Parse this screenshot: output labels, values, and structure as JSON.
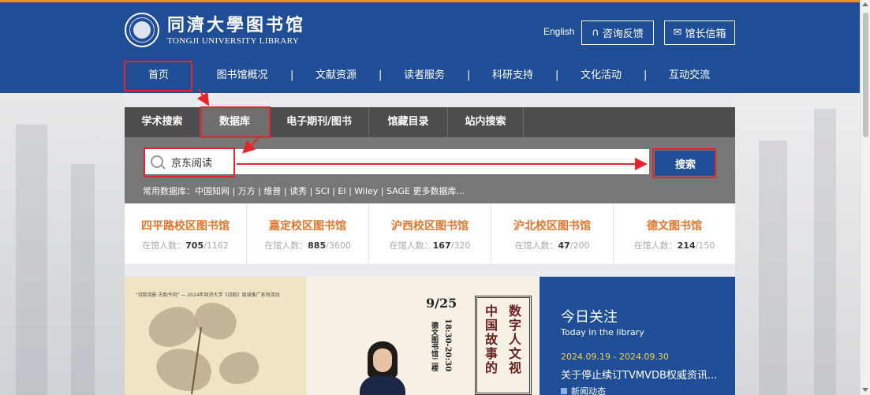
{
  "header": {
    "logo_cn": "同濟大學图书馆",
    "logo_en": "TONGJI UNIVERSITY LIBRARY",
    "lang_link": "English",
    "feedback_label": "咨询反馈",
    "feedback_icon": "headset-icon",
    "mailbox_label": "馆长信箱",
    "mailbox_icon": "mail-icon",
    "accent_color": "#1f4e96",
    "top_stripe_color": "#f08a24"
  },
  "nav": {
    "items": [
      "首页",
      "图书馆概况",
      "文献资源",
      "读者服务",
      "科研支持",
      "文化活动",
      "互动交流"
    ],
    "separator": "|"
  },
  "search": {
    "tabs": [
      "学术搜索",
      "数据库",
      "电子期刊/图书",
      "馆藏目录",
      "站内搜索"
    ],
    "active_tab": "数据库",
    "input_value": "京东阅读",
    "button_label": "搜索",
    "db_links_text": "常用数据库：中国知网 | 万方 | 维普 | 读秀 | SCI | EI | Wiley | SAGE   更多数据库..."
  },
  "campuses": [
    {
      "name": "四平路校区图书馆",
      "label": "在馆人数：",
      "current": "705",
      "capacity": "/1162"
    },
    {
      "name": "嘉定校区图书馆",
      "label": "在馆人数：",
      "current": "885",
      "capacity": "/3600"
    },
    {
      "name": "沪西校区图书馆",
      "label": "在馆人数：",
      "current": "167",
      "capacity": "/320"
    },
    {
      "name": "沪北校区图书馆",
      "label": "在馆人数：",
      "current": "47",
      "capacity": "/200"
    },
    {
      "name": "德文图书馆",
      "label": "在馆人数：",
      "current": "214",
      "capacity": "/150"
    }
  ],
  "banner": {
    "subtitle": "\"诗韵流影 古韵今风\" — 2024年同济大学《诗韵》阅读推广系列活动",
    "date": "9/25",
    "time": "18:30-20:30",
    "venue": "德文图书馆二楼",
    "scroll_col1": "中国故事的",
    "scroll_col2": "数字人文视"
  },
  "today": {
    "title": "今日关注",
    "subtitle": "Today in the library",
    "date_range": "2024.09.19 - 2024.09.30",
    "news_title": "关于停止续订TVMVDB权威资讯...",
    "news_tag": "新闻动态"
  }
}
